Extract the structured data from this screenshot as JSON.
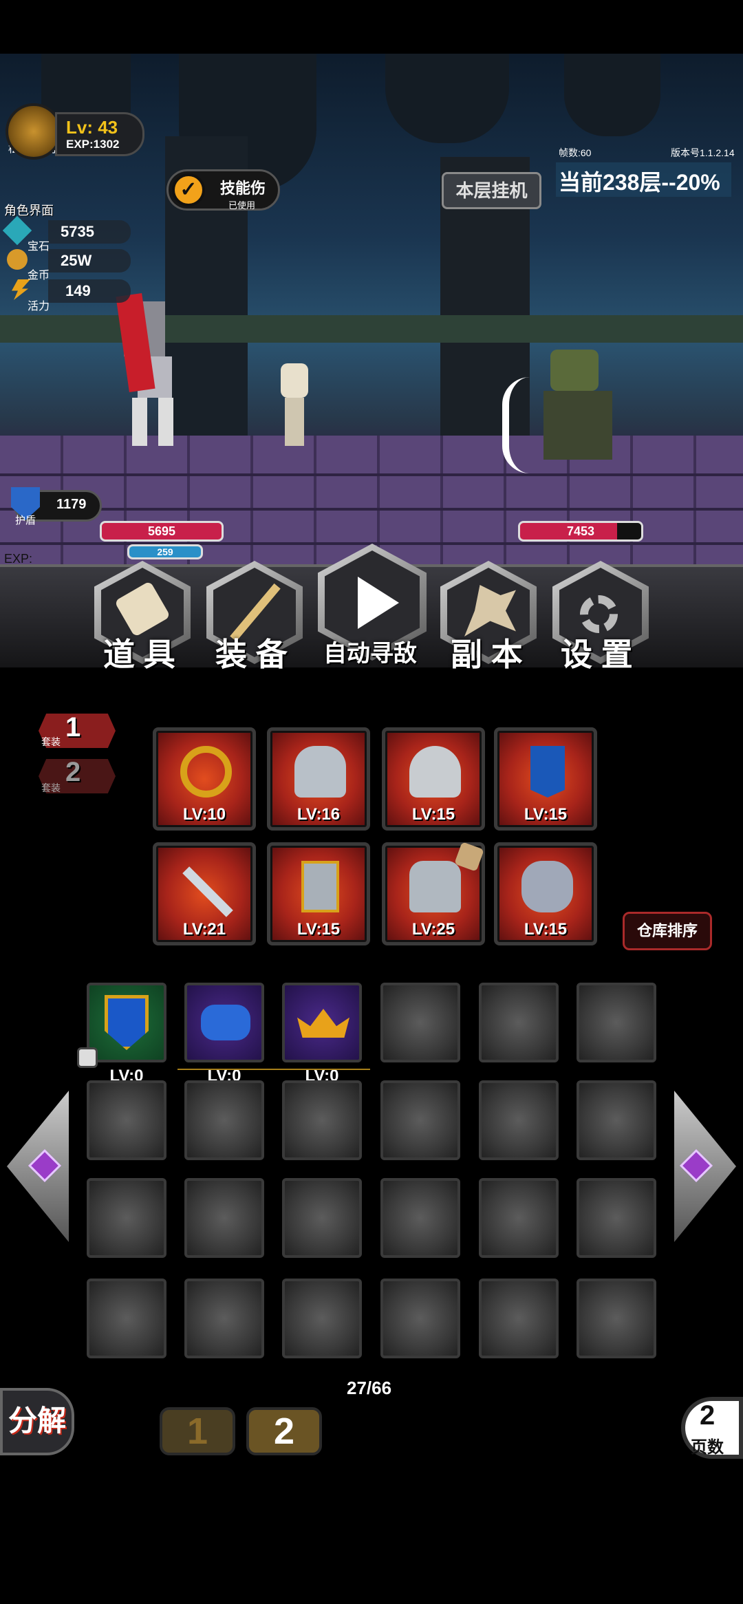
{
  "hud": {
    "player_id": "松岛菜菜子/ID:100185",
    "level": "Lv: 43",
    "exp": "EXP:1302",
    "role_screen": "角色界面",
    "gems_label": "宝石",
    "gems_value": "5735",
    "gold_label": "金币",
    "gold_value": "25W",
    "energy_label": "活力",
    "energy_value": "149",
    "skill_label": "技能伤",
    "skill_sub": "已使用",
    "idle_button": "本层挂机",
    "fps": "帧数:60",
    "version": "版本号1.1.2.14",
    "floor_progress": "当前238层--20%",
    "shield_value": "1179",
    "shield_label": "护盾",
    "exp_bar_label": "EXP:"
  },
  "battle": {
    "player_hp": "5695",
    "player_mp": "259",
    "enemy_hp": "7453"
  },
  "menu": {
    "items": "道 具",
    "equipment": "装 备",
    "auto_find": "自动寻敌",
    "dungeon": "副 本",
    "settings": "设 置"
  },
  "sets": [
    {
      "num": "1",
      "label": "套装"
    },
    {
      "num": "2",
      "label": "套装"
    }
  ],
  "equipment": [
    {
      "level": "LV:10",
      "icon": "ring-icon"
    },
    {
      "level": "LV:16",
      "icon": "gauntlet-icon"
    },
    {
      "level": "LV:15",
      "icon": "helmet-icon"
    },
    {
      "level": "LV:15",
      "icon": "banner-icon"
    },
    {
      "level": "LV:21",
      "icon": "dagger-icon"
    },
    {
      "level": "LV:15",
      "icon": "door-icon"
    },
    {
      "level": "LV:25",
      "icon": "armor-icon"
    },
    {
      "level": "LV:15",
      "icon": "boots-icon"
    }
  ],
  "warehouse_sort": "仓库排序",
  "inventory": {
    "items": [
      {
        "level": "LV:0",
        "icon": "shield-item-icon"
      },
      {
        "level": "LV:0",
        "icon": "glove-item-icon"
      },
      {
        "level": "LV:0",
        "icon": "crown-item-icon"
      }
    ],
    "count": "27/66"
  },
  "decompose": "分解",
  "pages": [
    "1",
    "2"
  ],
  "page_count": "2",
  "page_count_label": "页数"
}
